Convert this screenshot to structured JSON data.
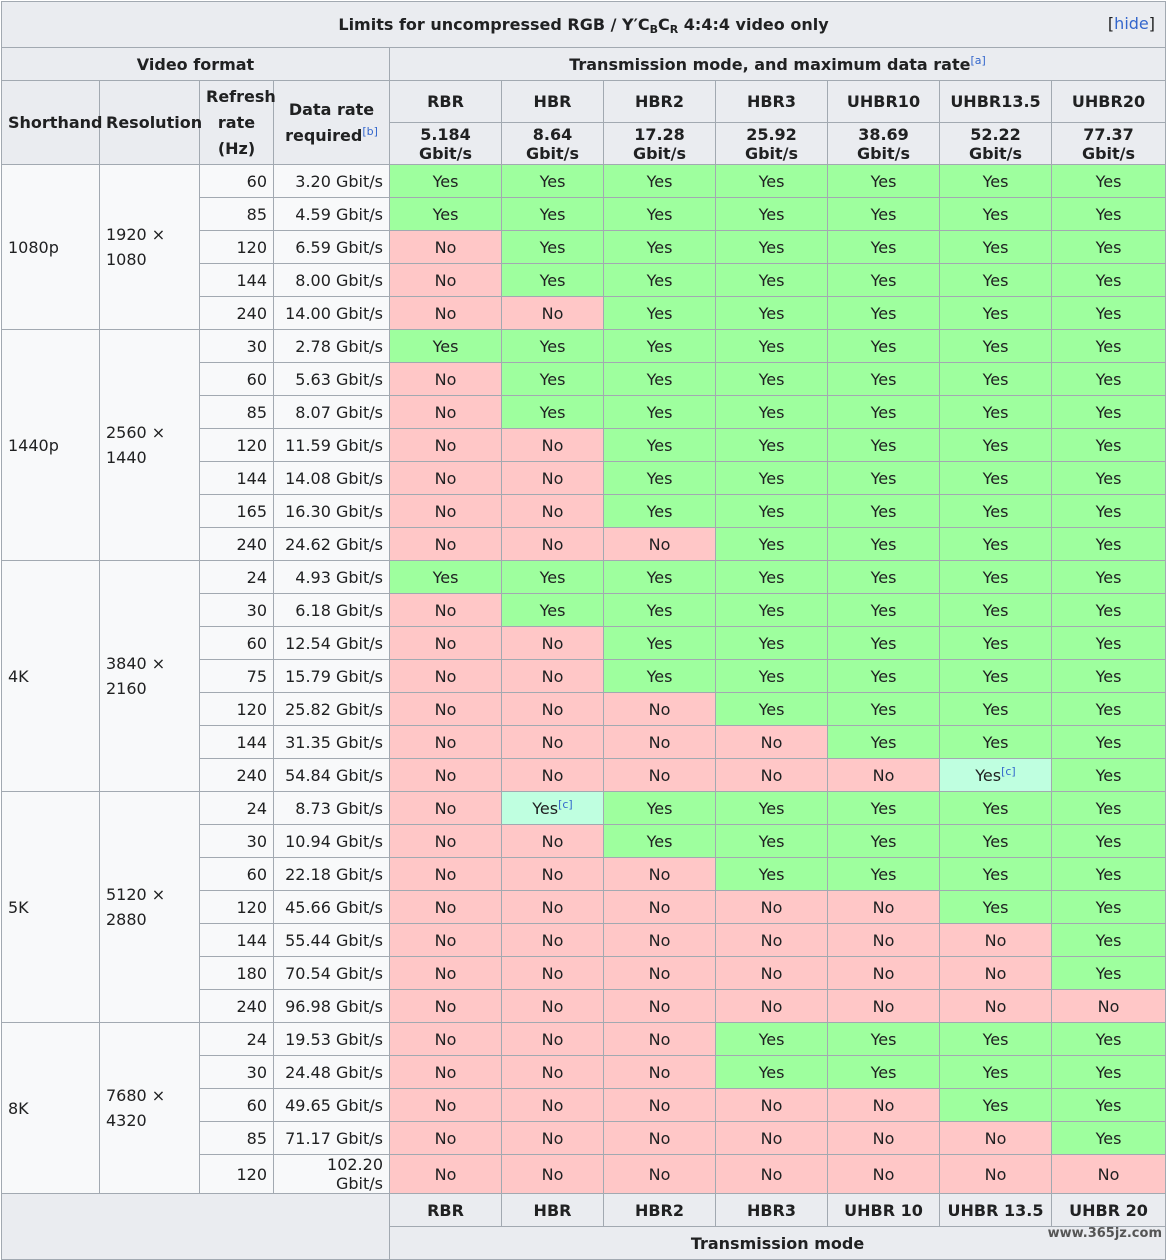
{
  "caption": {
    "prefix": "Limits for uncompressed RGB / Y′C",
    "sub_b": "B",
    "mid": "C",
    "sub_r": "R",
    "suffix": " 4:4:4 video only",
    "hide_open": "[",
    "hide_label": "hide",
    "hide_close": "]"
  },
  "headers": {
    "video_format": "Video format",
    "transmission": "Transmission mode, and maximum data rate",
    "transmission_ref": "[a]",
    "shorthand": "Shorthand",
    "resolution": "Resolution",
    "refresh_line1": "Refresh",
    "refresh_line2": "rate",
    "refresh_line3": "(Hz)",
    "datarate_line1": "Data rate",
    "datarate_line2": "required",
    "datarate_ref": "[b]"
  },
  "modes": [
    {
      "name": "RBR",
      "rate": "5.184 Gbit/s"
    },
    {
      "name": "HBR",
      "rate": "8.64 Gbit/s"
    },
    {
      "name": "HBR2",
      "rate": "17.28 Gbit/s"
    },
    {
      "name": "HBR3",
      "rate": "25.92 Gbit/s"
    },
    {
      "name": "UHBR10",
      "rate": "38.69 Gbit/s"
    },
    {
      "name": "UHBR13.5",
      "rate": "52.22 Gbit/s"
    },
    {
      "name": "UHBR20",
      "rate": "77.37 Gbit/s"
    }
  ],
  "groups": [
    {
      "shorthand": "1080p",
      "resolution_line1": "1920 ×",
      "resolution_line2": "1080",
      "rows": [
        {
          "hz": "60",
          "rate": "3.20 Gbit/s",
          "cells": [
            "Yes",
            "Yes",
            "Yes",
            "Yes",
            "Yes",
            "Yes",
            "Yes"
          ]
        },
        {
          "hz": "85",
          "rate": "4.59 Gbit/s",
          "cells": [
            "Yes",
            "Yes",
            "Yes",
            "Yes",
            "Yes",
            "Yes",
            "Yes"
          ]
        },
        {
          "hz": "120",
          "rate": "6.59 Gbit/s",
          "cells": [
            "No",
            "Yes",
            "Yes",
            "Yes",
            "Yes",
            "Yes",
            "Yes"
          ]
        },
        {
          "hz": "144",
          "rate": "8.00 Gbit/s",
          "cells": [
            "No",
            "Yes",
            "Yes",
            "Yes",
            "Yes",
            "Yes",
            "Yes"
          ]
        },
        {
          "hz": "240",
          "rate": "14.00 Gbit/s",
          "cells": [
            "No",
            "No",
            "Yes",
            "Yes",
            "Yes",
            "Yes",
            "Yes"
          ]
        }
      ]
    },
    {
      "shorthand": "1440p",
      "resolution_line1": "2560 ×",
      "resolution_line2": "1440",
      "rows": [
        {
          "hz": "30",
          "rate": "2.78 Gbit/s",
          "cells": [
            "Yes",
            "Yes",
            "Yes",
            "Yes",
            "Yes",
            "Yes",
            "Yes"
          ]
        },
        {
          "hz": "60",
          "rate": "5.63 Gbit/s",
          "cells": [
            "No",
            "Yes",
            "Yes",
            "Yes",
            "Yes",
            "Yes",
            "Yes"
          ]
        },
        {
          "hz": "85",
          "rate": "8.07 Gbit/s",
          "cells": [
            "No",
            "Yes",
            "Yes",
            "Yes",
            "Yes",
            "Yes",
            "Yes"
          ]
        },
        {
          "hz": "120",
          "rate": "11.59 Gbit/s",
          "cells": [
            "No",
            "No",
            "Yes",
            "Yes",
            "Yes",
            "Yes",
            "Yes"
          ]
        },
        {
          "hz": "144",
          "rate": "14.08 Gbit/s",
          "cells": [
            "No",
            "No",
            "Yes",
            "Yes",
            "Yes",
            "Yes",
            "Yes"
          ]
        },
        {
          "hz": "165",
          "rate": "16.30 Gbit/s",
          "cells": [
            "No",
            "No",
            "Yes",
            "Yes",
            "Yes",
            "Yes",
            "Yes"
          ]
        },
        {
          "hz": "240",
          "rate": "24.62 Gbit/s",
          "cells": [
            "No",
            "No",
            "No",
            "Yes",
            "Yes",
            "Yes",
            "Yes"
          ]
        }
      ]
    },
    {
      "shorthand": "4K",
      "resolution_line1": "3840 ×",
      "resolution_line2": "2160",
      "rows": [
        {
          "hz": "24",
          "rate": "4.93 Gbit/s",
          "cells": [
            "Yes",
            "Yes",
            "Yes",
            "Yes",
            "Yes",
            "Yes",
            "Yes"
          ]
        },
        {
          "hz": "30",
          "rate": "6.18 Gbit/s",
          "cells": [
            "No",
            "Yes",
            "Yes",
            "Yes",
            "Yes",
            "Yes",
            "Yes"
          ]
        },
        {
          "hz": "60",
          "rate": "12.54 Gbit/s",
          "cells": [
            "No",
            "No",
            "Yes",
            "Yes",
            "Yes",
            "Yes",
            "Yes"
          ]
        },
        {
          "hz": "75",
          "rate": "15.79 Gbit/s",
          "cells": [
            "No",
            "No",
            "Yes",
            "Yes",
            "Yes",
            "Yes",
            "Yes"
          ]
        },
        {
          "hz": "120",
          "rate": "25.82 Gbit/s",
          "cells": [
            "No",
            "No",
            "No",
            "Yes",
            "Yes",
            "Yes",
            "Yes"
          ]
        },
        {
          "hz": "144",
          "rate": "31.35 Gbit/s",
          "cells": [
            "No",
            "No",
            "No",
            "No",
            "Yes",
            "Yes",
            "Yes"
          ]
        },
        {
          "hz": "240",
          "rate": "54.84 Gbit/s",
          "cells": [
            "No",
            "No",
            "No",
            "No",
            "No",
            "Yes[c]",
            "Yes"
          ]
        }
      ]
    },
    {
      "shorthand": "5K",
      "resolution_line1": "5120 ×",
      "resolution_line2": "2880",
      "rows": [
        {
          "hz": "24",
          "rate": "8.73 Gbit/s",
          "cells": [
            "No",
            "Yes[c]",
            "Yes",
            "Yes",
            "Yes",
            "Yes",
            "Yes"
          ]
        },
        {
          "hz": "30",
          "rate": "10.94 Gbit/s",
          "cells": [
            "No",
            "No",
            "Yes",
            "Yes",
            "Yes",
            "Yes",
            "Yes"
          ]
        },
        {
          "hz": "60",
          "rate": "22.18 Gbit/s",
          "cells": [
            "No",
            "No",
            "No",
            "Yes",
            "Yes",
            "Yes",
            "Yes"
          ]
        },
        {
          "hz": "120",
          "rate": "45.66 Gbit/s",
          "cells": [
            "No",
            "No",
            "No",
            "No",
            "No",
            "Yes",
            "Yes"
          ]
        },
        {
          "hz": "144",
          "rate": "55.44 Gbit/s",
          "cells": [
            "No",
            "No",
            "No",
            "No",
            "No",
            "No",
            "Yes"
          ]
        },
        {
          "hz": "180",
          "rate": "70.54 Gbit/s",
          "cells": [
            "No",
            "No",
            "No",
            "No",
            "No",
            "No",
            "Yes"
          ]
        },
        {
          "hz": "240",
          "rate": "96.98 Gbit/s",
          "cells": [
            "No",
            "No",
            "No",
            "No",
            "No",
            "No",
            "No"
          ]
        }
      ]
    },
    {
      "shorthand": "8K",
      "resolution_line1": "7680 ×",
      "resolution_line2": "4320",
      "rows": [
        {
          "hz": "24",
          "rate": "19.53 Gbit/s",
          "cells": [
            "No",
            "No",
            "No",
            "Yes",
            "Yes",
            "Yes",
            "Yes"
          ]
        },
        {
          "hz": "30",
          "rate": "24.48 Gbit/s",
          "cells": [
            "No",
            "No",
            "No",
            "Yes",
            "Yes",
            "Yes",
            "Yes"
          ]
        },
        {
          "hz": "60",
          "rate": "49.65 Gbit/s",
          "cells": [
            "No",
            "No",
            "No",
            "No",
            "No",
            "Yes",
            "Yes"
          ]
        },
        {
          "hz": "85",
          "rate": "71.17 Gbit/s",
          "cells": [
            "No",
            "No",
            "No",
            "No",
            "No",
            "No",
            "Yes"
          ]
        },
        {
          "hz": "120",
          "rate": "102.20 Gbit/s",
          "cells": [
            "No",
            "No",
            "No",
            "No",
            "No",
            "No",
            "No"
          ]
        }
      ]
    }
  ],
  "footer": {
    "modes": [
      "RBR",
      "HBR",
      "HBR2",
      "HBR3",
      "UHBR 10",
      "UHBR 13.5",
      "UHBR 20"
    ],
    "label": "Transmission mode"
  },
  "watermark": "www.365jz.com",
  "colors": {
    "yes": "#9eff9e",
    "no": "#ffc7c7",
    "partial": "#bfffe0",
    "header_bg": "#eaecf0",
    "link": "#3366cc"
  }
}
